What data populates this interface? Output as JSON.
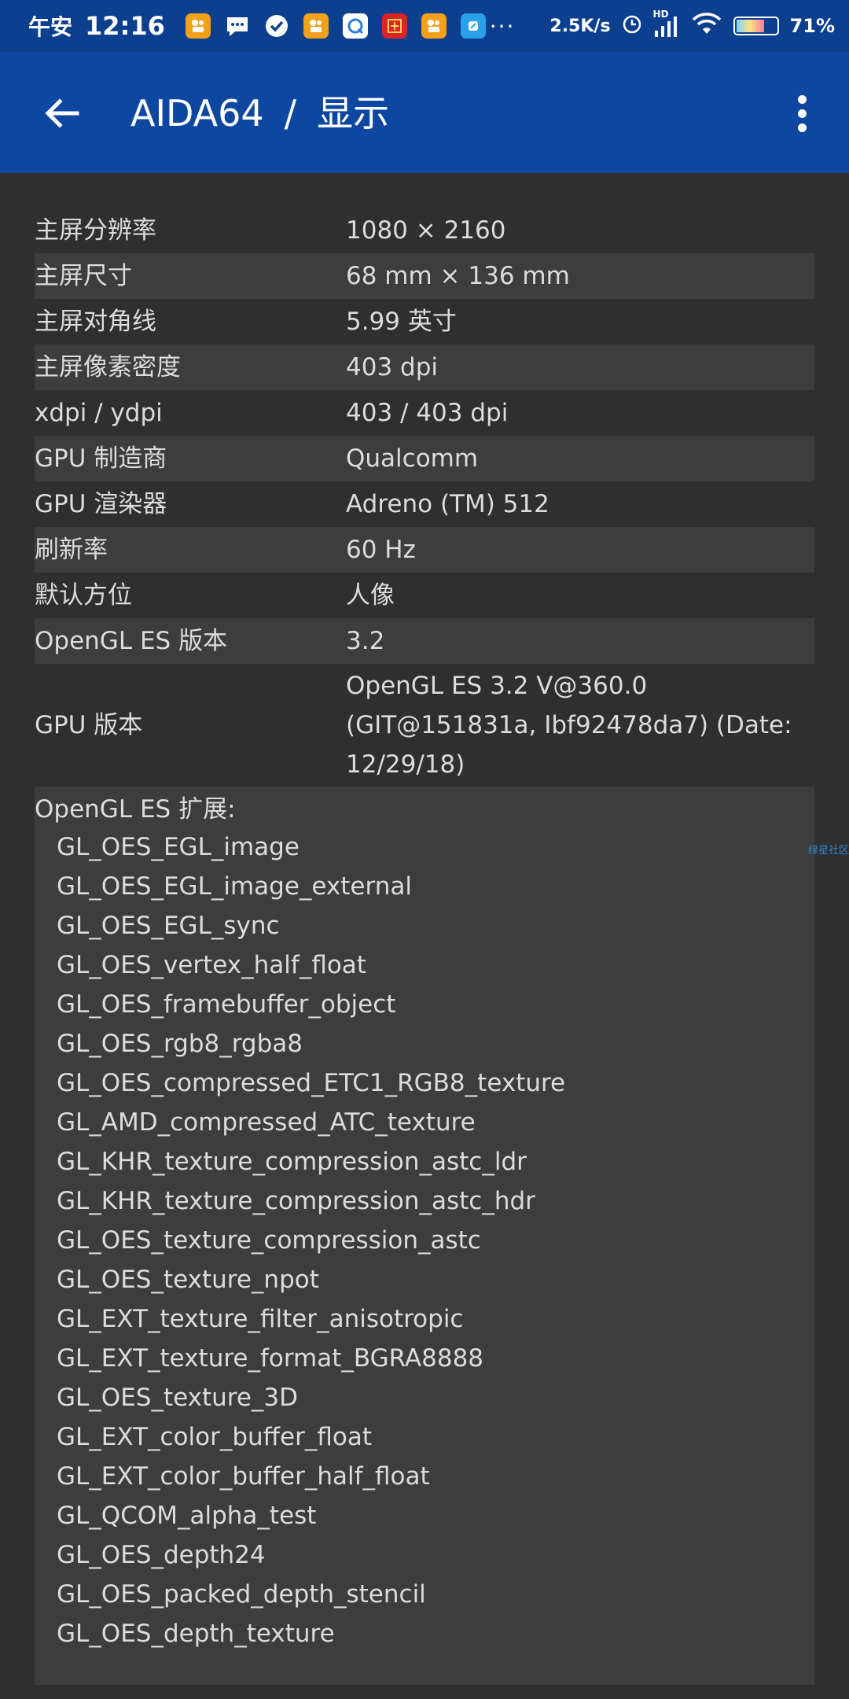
{
  "status_bar": {
    "time_prefix": "午安",
    "time": "12:16",
    "dots": "···",
    "speed": "2.5K/s",
    "network": "HD",
    "battery_percent": "71%",
    "battery_level": 0.71,
    "notification_icons": [
      "kuaishou-icon",
      "message-icon",
      "check-icon",
      "kuaishou-icon",
      "camera-app-icon",
      "red-app-icon",
      "kuaishou-icon",
      "blue-app-icon"
    ]
  },
  "app_bar": {
    "app_name": "AIDA64",
    "separator": "/",
    "section": "显示",
    "color": "#0d47a1"
  },
  "rows": [
    {
      "key": "主屏分辨率",
      "value": "1080 × 2160"
    },
    {
      "key": "主屏尺寸",
      "value": "68 mm × 136 mm"
    },
    {
      "key": "主屏对角线",
      "value": "5.99 英寸"
    },
    {
      "key": "主屏像素密度",
      "value": "403 dpi"
    },
    {
      "key": "xdpi / ydpi",
      "value": "403 / 403 dpi"
    },
    {
      "key": "GPU 制造商",
      "value": "Qualcomm"
    },
    {
      "key": "GPU 渲染器",
      "value": "Adreno (TM) 512"
    },
    {
      "key": "刷新率",
      "value": "60 Hz"
    },
    {
      "key": "默认方位",
      "value": "人像"
    },
    {
      "key": "OpenGL ES 版本",
      "value": "3.2"
    },
    {
      "key": "GPU 版本",
      "value_lines": [
        "OpenGL ES 3.2 V@360.0",
        "(GIT@151831a, Ibf92478da7) (Date:",
        "12/29/18)"
      ]
    }
  ],
  "extensions": {
    "title": "OpenGL ES 扩展:",
    "items": [
      "GL_OES_EGL_image",
      "GL_OES_EGL_image_external",
      "GL_OES_EGL_sync",
      "GL_OES_vertex_half_float",
      "GL_OES_framebuffer_object",
      "GL_OES_rgb8_rgba8",
      "GL_OES_compressed_ETC1_RGB8_texture",
      "GL_AMD_compressed_ATC_texture",
      "GL_KHR_texture_compression_astc_ldr",
      "GL_KHR_texture_compression_astc_hdr",
      "GL_OES_texture_compression_astc",
      "GL_OES_texture_npot",
      "GL_EXT_texture_filter_anisotropic",
      "GL_EXT_texture_format_BGRA8888",
      "GL_OES_texture_3D",
      "GL_EXT_color_buffer_float",
      "GL_EXT_color_buffer_half_float",
      "GL_QCOM_alpha_test",
      "GL_OES_depth24",
      "GL_OES_packed_depth_stencil",
      "GL_OES_depth_texture"
    ]
  },
  "watermark": "绿星社区"
}
